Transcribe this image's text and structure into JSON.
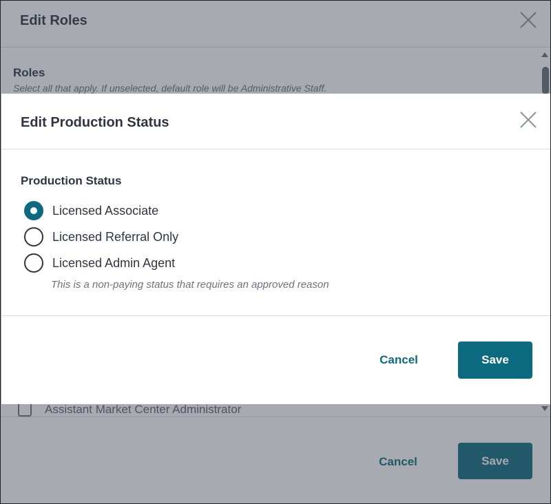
{
  "background_dialog": {
    "title": "Edit Roles",
    "close_icon": "close-icon",
    "roles_label": "Roles",
    "roles_help": "Select all that apply. If unselected, default role will be Administrative Staff.",
    "visible_checkbox_label": "Assistant Market Center Administrator",
    "cancel_label": "Cancel",
    "save_label": "Save"
  },
  "modal": {
    "title": "Edit Production Status",
    "close_icon": "close-icon",
    "section_label": "Production Status",
    "options": [
      {
        "label": "Licensed Associate",
        "selected": true
      },
      {
        "label": "Licensed Referral Only",
        "selected": false
      },
      {
        "label": "Licensed Admin Agent",
        "selected": false
      }
    ],
    "admin_agent_help": "This is a non-paying status that requires an approved reason",
    "cancel_label": "Cancel",
    "save_label": "Save"
  },
  "colors": {
    "accent": "#0b6a80",
    "text": "#2f3542",
    "muted": "#6c7280"
  }
}
